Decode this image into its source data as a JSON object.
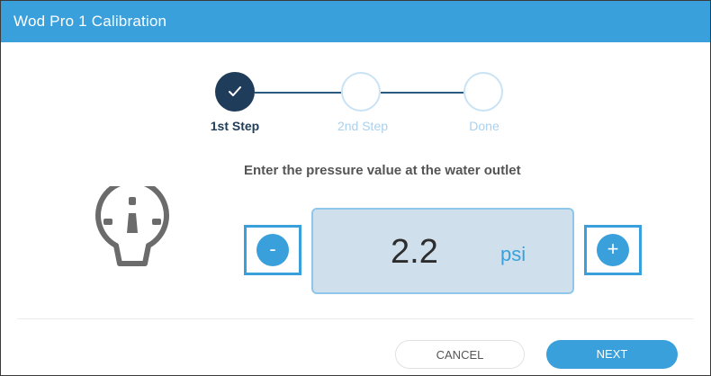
{
  "window": {
    "title": "Wod Pro 1 Calibration"
  },
  "stepper": {
    "steps": [
      {
        "label": "1st Step",
        "state": "completed"
      },
      {
        "label": "2nd Step",
        "state": "pending"
      },
      {
        "label": "Done",
        "state": "pending"
      }
    ]
  },
  "main": {
    "instruction": "Enter the pressure value at the water outlet",
    "icon": "pressure-gauge-icon",
    "value": "2.2",
    "unit": "psi",
    "decrement_label": "-",
    "increment_label": "+"
  },
  "footer": {
    "cancel_label": "CANCEL",
    "next_label": "NEXT"
  },
  "colors": {
    "accent": "#3aa0dc",
    "step_completed": "#1f3d5b",
    "value_box_bg": "#cfe0ec"
  }
}
